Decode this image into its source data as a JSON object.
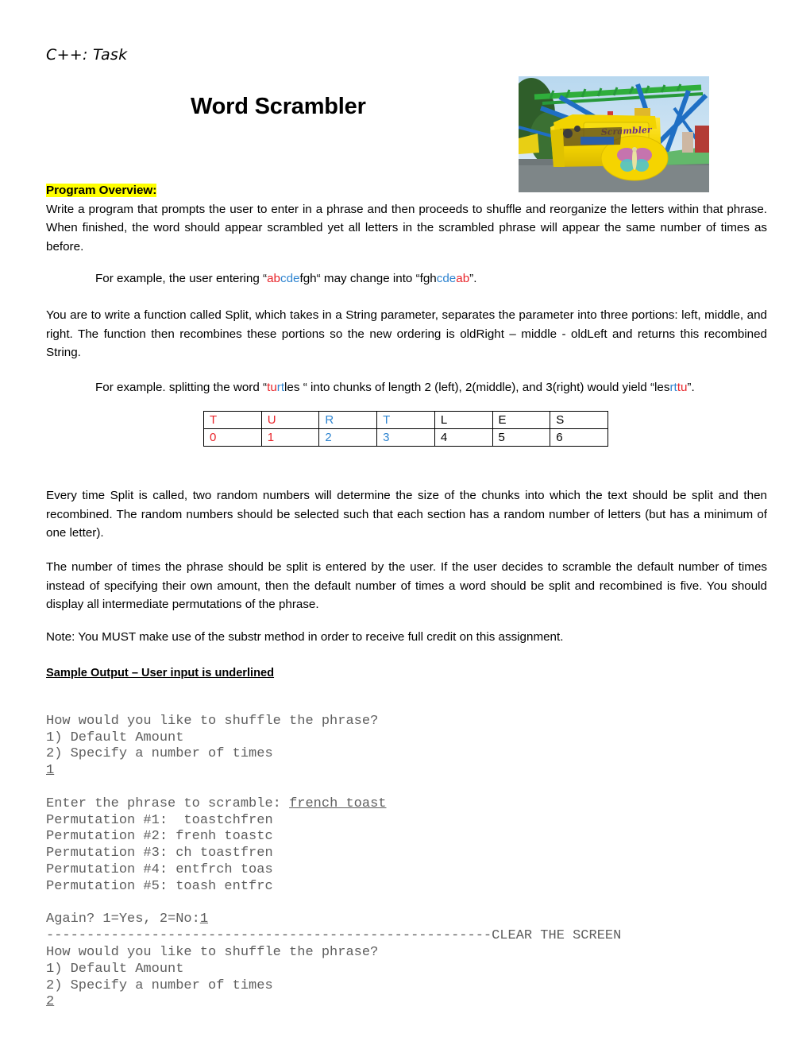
{
  "header": {
    "kicker": "C++: Task",
    "title": "Word Scrambler",
    "photo_alt": "scrambler-carnival-ride-photo"
  },
  "overview": {
    "heading": "Program Overview:",
    "paragraph": "Write a program that prompts the user to enter in a phrase and then proceeds to shuffle and reorganize the letters within that phrase.  When finished, the word should appear scrambled yet all letters in the scrambled phrase will appear the same number of times as before."
  },
  "example_one": {
    "lead": "For example, the user entering “",
    "input_red": "ab",
    "input_blue": "cde",
    "input_black": "fgh",
    "middle": "“ may change into “fgh",
    "output_blue": "cde",
    "output_red": "ab",
    "tail": "”."
  },
  "split_paragraph": "You are to write a function called Split, which takes in a String parameter, separates the parameter into three portions: left, middle, and right.  The function then recombines these portions so the new ordering is oldRight – middle - oldLeft and returns this recombined String.",
  "example_two": {
    "lead": "For example.  splitting the word “",
    "word_red": "tu",
    "word_blue": "rt",
    "word_black": "les",
    "middle": " “ into chunks of length 2 (left), 2(middle), and 3(right) would yield “les",
    "result_blue": "rt",
    "result_red": "tu",
    "tail": "”."
  },
  "table": {
    "letters": [
      {
        "text": "T",
        "color": "red"
      },
      {
        "text": "U",
        "color": "red"
      },
      {
        "text": "R",
        "color": "blue"
      },
      {
        "text": "T",
        "color": "blue"
      },
      {
        "text": "L",
        "color": "black"
      },
      {
        "text": "E",
        "color": "black"
      },
      {
        "text": "S",
        "color": "black"
      }
    ],
    "indices": [
      {
        "text": "0",
        "color": "red"
      },
      {
        "text": "1",
        "color": "red"
      },
      {
        "text": "2",
        "color": "blue"
      },
      {
        "text": "3",
        "color": "blue"
      },
      {
        "text": "4",
        "color": "black"
      },
      {
        "text": "5",
        "color": "black"
      },
      {
        "text": "6",
        "color": "black"
      }
    ]
  },
  "paragraph_random": "Every time Split is called, two random numbers will determine the size of the chunks into which the text should be split and then recombined.  The random numbers should be selected such that each section has a random number of letters (but has a minimum of one letter).",
  "paragraph_times": "The number of times the phrase should be split is entered by the user.  If the user decides to scramble the default number of times instead of specifying their own amount, then the default number of times a word should be split and recombined is five. You should display all intermediate permutations of the phrase.",
  "paragraph_note": "Note: You MUST make use of the substr method in order to receive full credit on this assignment.",
  "sample_output_heading": "Sample Output – User input is underlined",
  "console": {
    "l1": "How would you like to shuffle the phrase?",
    "l2": "1) Default Amount",
    "l3": "2) Specify a number of times",
    "l4_input": "1",
    "l5_prompt": "Enter the phrase to scramble: ",
    "l5_input": "french toast",
    "l6": "Permutation #1:  toastchfren",
    "l7": "Permutation #2: frenh toastc",
    "l8": "Permutation #3: ch toastfren",
    "l9": "Permutation #4: entfrch toas",
    "l10": "Permutation #5: toash entfrc",
    "l11_prompt": "Again? 1=Yes, 2=No:",
    "l11_input": "1",
    "l12_dashes": "-------------------------------------------------------",
    "l12_label": "CLEAR THE SCREEN",
    "l13": "How would you like to shuffle the phrase?",
    "l14": "1) Default Amount",
    "l15": "2) Specify a number of times",
    "l16_input": "2"
  },
  "colors": {
    "highlight": "#FFFF00",
    "red": "#E8242A",
    "blue": "#2E84D0",
    "console_text": "#5e5e5e"
  }
}
